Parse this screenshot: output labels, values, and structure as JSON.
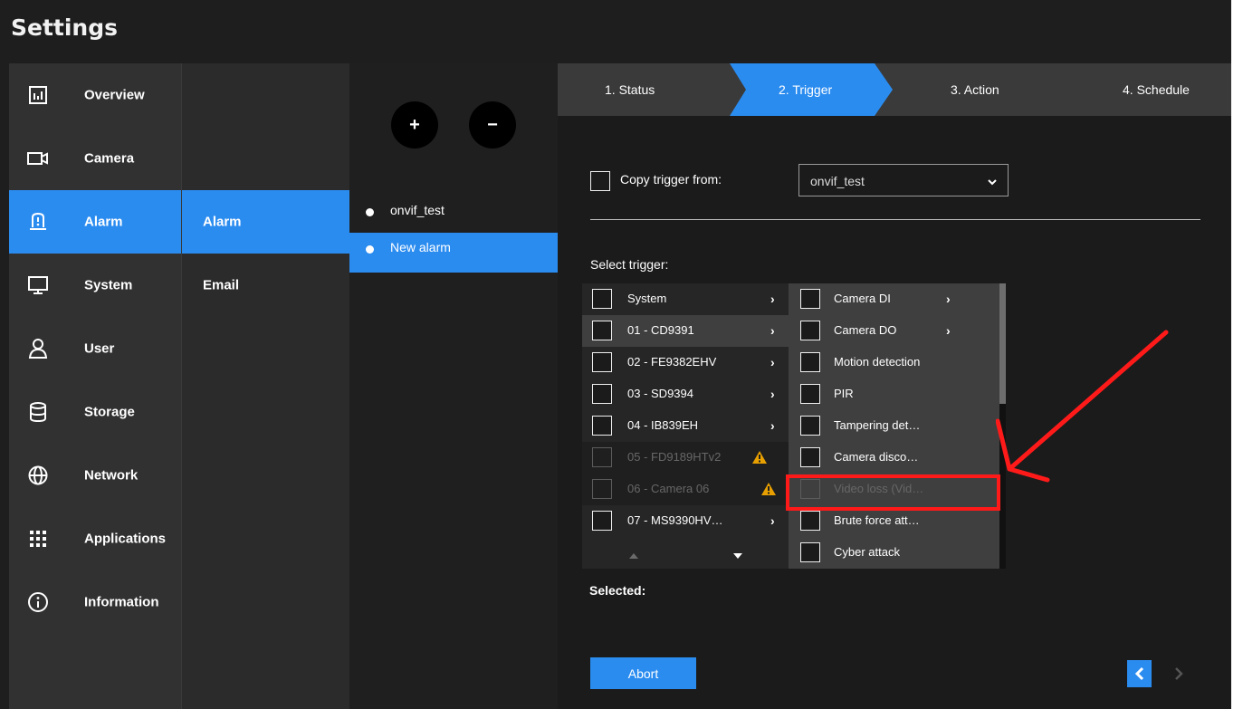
{
  "header": {
    "title": "Settings"
  },
  "sidebar": {
    "items": [
      {
        "label": "Overview",
        "icon": "chart-icon"
      },
      {
        "label": "Camera",
        "icon": "camera-icon"
      },
      {
        "label": "Alarm",
        "icon": "alarm-icon",
        "active": true
      },
      {
        "label": "System",
        "icon": "monitor-icon"
      },
      {
        "label": "User",
        "icon": "user-icon"
      },
      {
        "label": "Storage",
        "icon": "database-icon"
      },
      {
        "label": "Network",
        "icon": "globe-icon"
      },
      {
        "label": "Applications",
        "icon": "grid-icon"
      },
      {
        "label": "Information",
        "icon": "info-icon"
      }
    ]
  },
  "submenu": {
    "items": [
      {
        "label": "Alarm",
        "active": true
      },
      {
        "label": "Email"
      }
    ]
  },
  "alarm_list": {
    "add_label": "+",
    "remove_label": "−",
    "items": [
      {
        "label": "onvif_test"
      },
      {
        "label": "New alarm",
        "active": true
      }
    ]
  },
  "wizard": {
    "steps": [
      {
        "label": "1. Status"
      },
      {
        "label": "2. Trigger",
        "active": true
      },
      {
        "label": "3. Action"
      },
      {
        "label": "4. Schedule"
      }
    ]
  },
  "copy_trigger": {
    "label": "Copy trigger from:",
    "selected": "onvif_test"
  },
  "select_trigger_label": "Select trigger:",
  "devices": [
    {
      "label": "System",
      "enabled": true
    },
    {
      "label": "01 - CD9391",
      "enabled": true
    },
    {
      "label": "02 - FE9382EHV",
      "enabled": true
    },
    {
      "label": "03 - SD9394",
      "enabled": true
    },
    {
      "label": "04 - IB839EH",
      "enabled": true
    },
    {
      "label": "05 - FD9189HTv2",
      "enabled": false,
      "warning": true
    },
    {
      "label": "06 - Camera 06",
      "enabled": false,
      "warning": true
    },
    {
      "label": "07 - MS9390HV…",
      "enabled": true
    }
  ],
  "triggers": [
    {
      "label": "Camera DI",
      "enabled": true,
      "submenu": true
    },
    {
      "label": "Camera DO",
      "enabled": true,
      "submenu": true
    },
    {
      "label": "Motion detection",
      "enabled": true
    },
    {
      "label": "PIR",
      "enabled": true
    },
    {
      "label": "Tampering det…",
      "enabled": true
    },
    {
      "label": "Camera disco…",
      "enabled": true
    },
    {
      "label": "Video loss (Vid…",
      "enabled": false
    },
    {
      "label": "Brute force att…",
      "enabled": true
    },
    {
      "label": "Cyber attack",
      "enabled": true
    }
  ],
  "selected_label": "Selected:",
  "buttons": {
    "abort": "Abort"
  },
  "colors": {
    "accent": "#2b8cf0",
    "annotation": "#ff1a1a",
    "warning": "#e8a000"
  }
}
